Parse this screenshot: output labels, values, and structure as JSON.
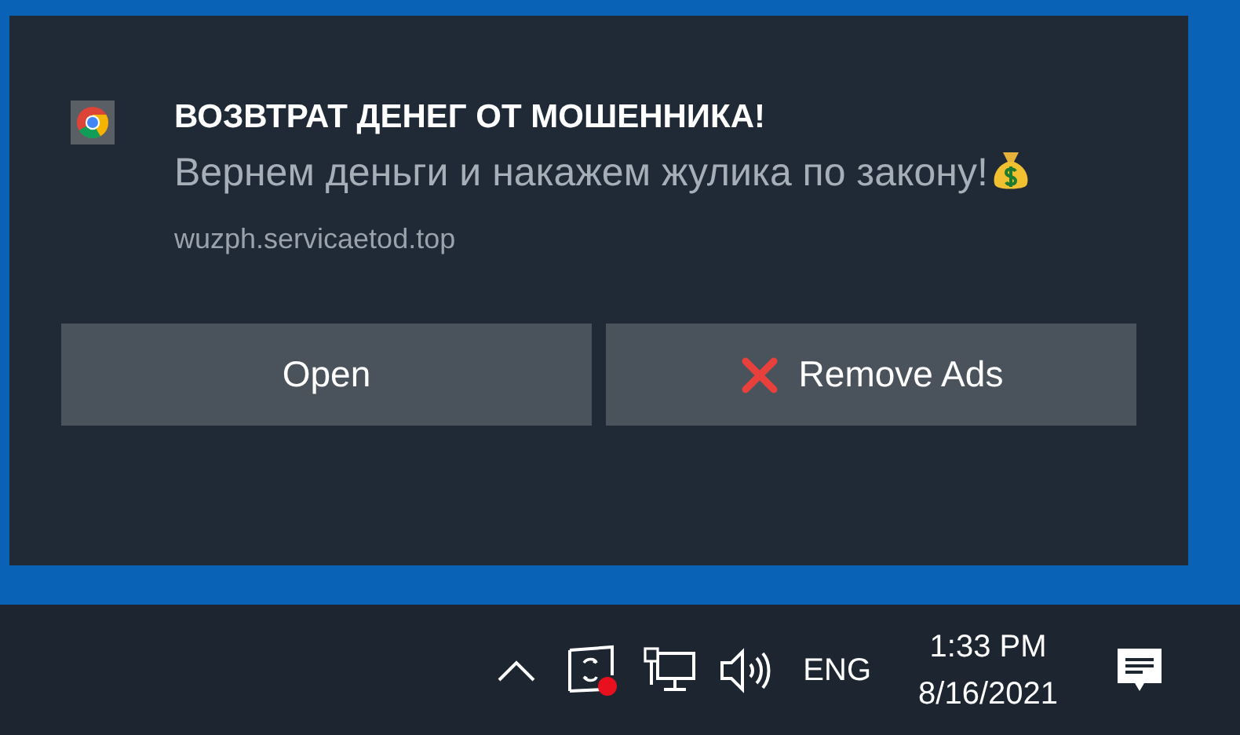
{
  "notification": {
    "title": "ВОЗВТРАТ ДЕНЕГ ОТ МОШЕННИКА!",
    "body": "Вернем деньги и накажем жулика по закону!",
    "source": "wuzph.servicaetod.top",
    "buttons": [
      {
        "label": "Open",
        "kind": "plain"
      },
      {
        "label": "Remove Ads",
        "kind": "remove"
      }
    ]
  },
  "taskbar": {
    "language": "ENG",
    "time": "1:33 PM",
    "date": "8/16/2021"
  }
}
